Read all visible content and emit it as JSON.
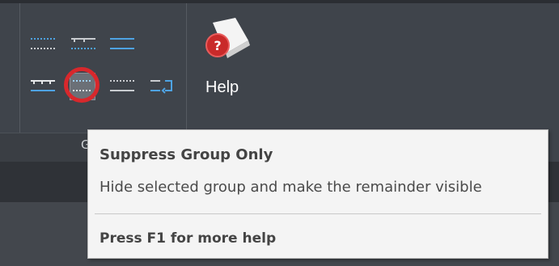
{
  "help": {
    "label": "Help",
    "icon": "help-book-icon"
  },
  "ribbon_group": {
    "label": "G"
  },
  "tooltip": {
    "title": "Suppress Group Only",
    "description": "Hide selected group and make the remainder visible",
    "footer": "Press F1 for more help"
  },
  "colors": {
    "highlight": "#d8282c",
    "ribbon": "#3f444b",
    "tooltip_bg": "#f4f4f4"
  }
}
